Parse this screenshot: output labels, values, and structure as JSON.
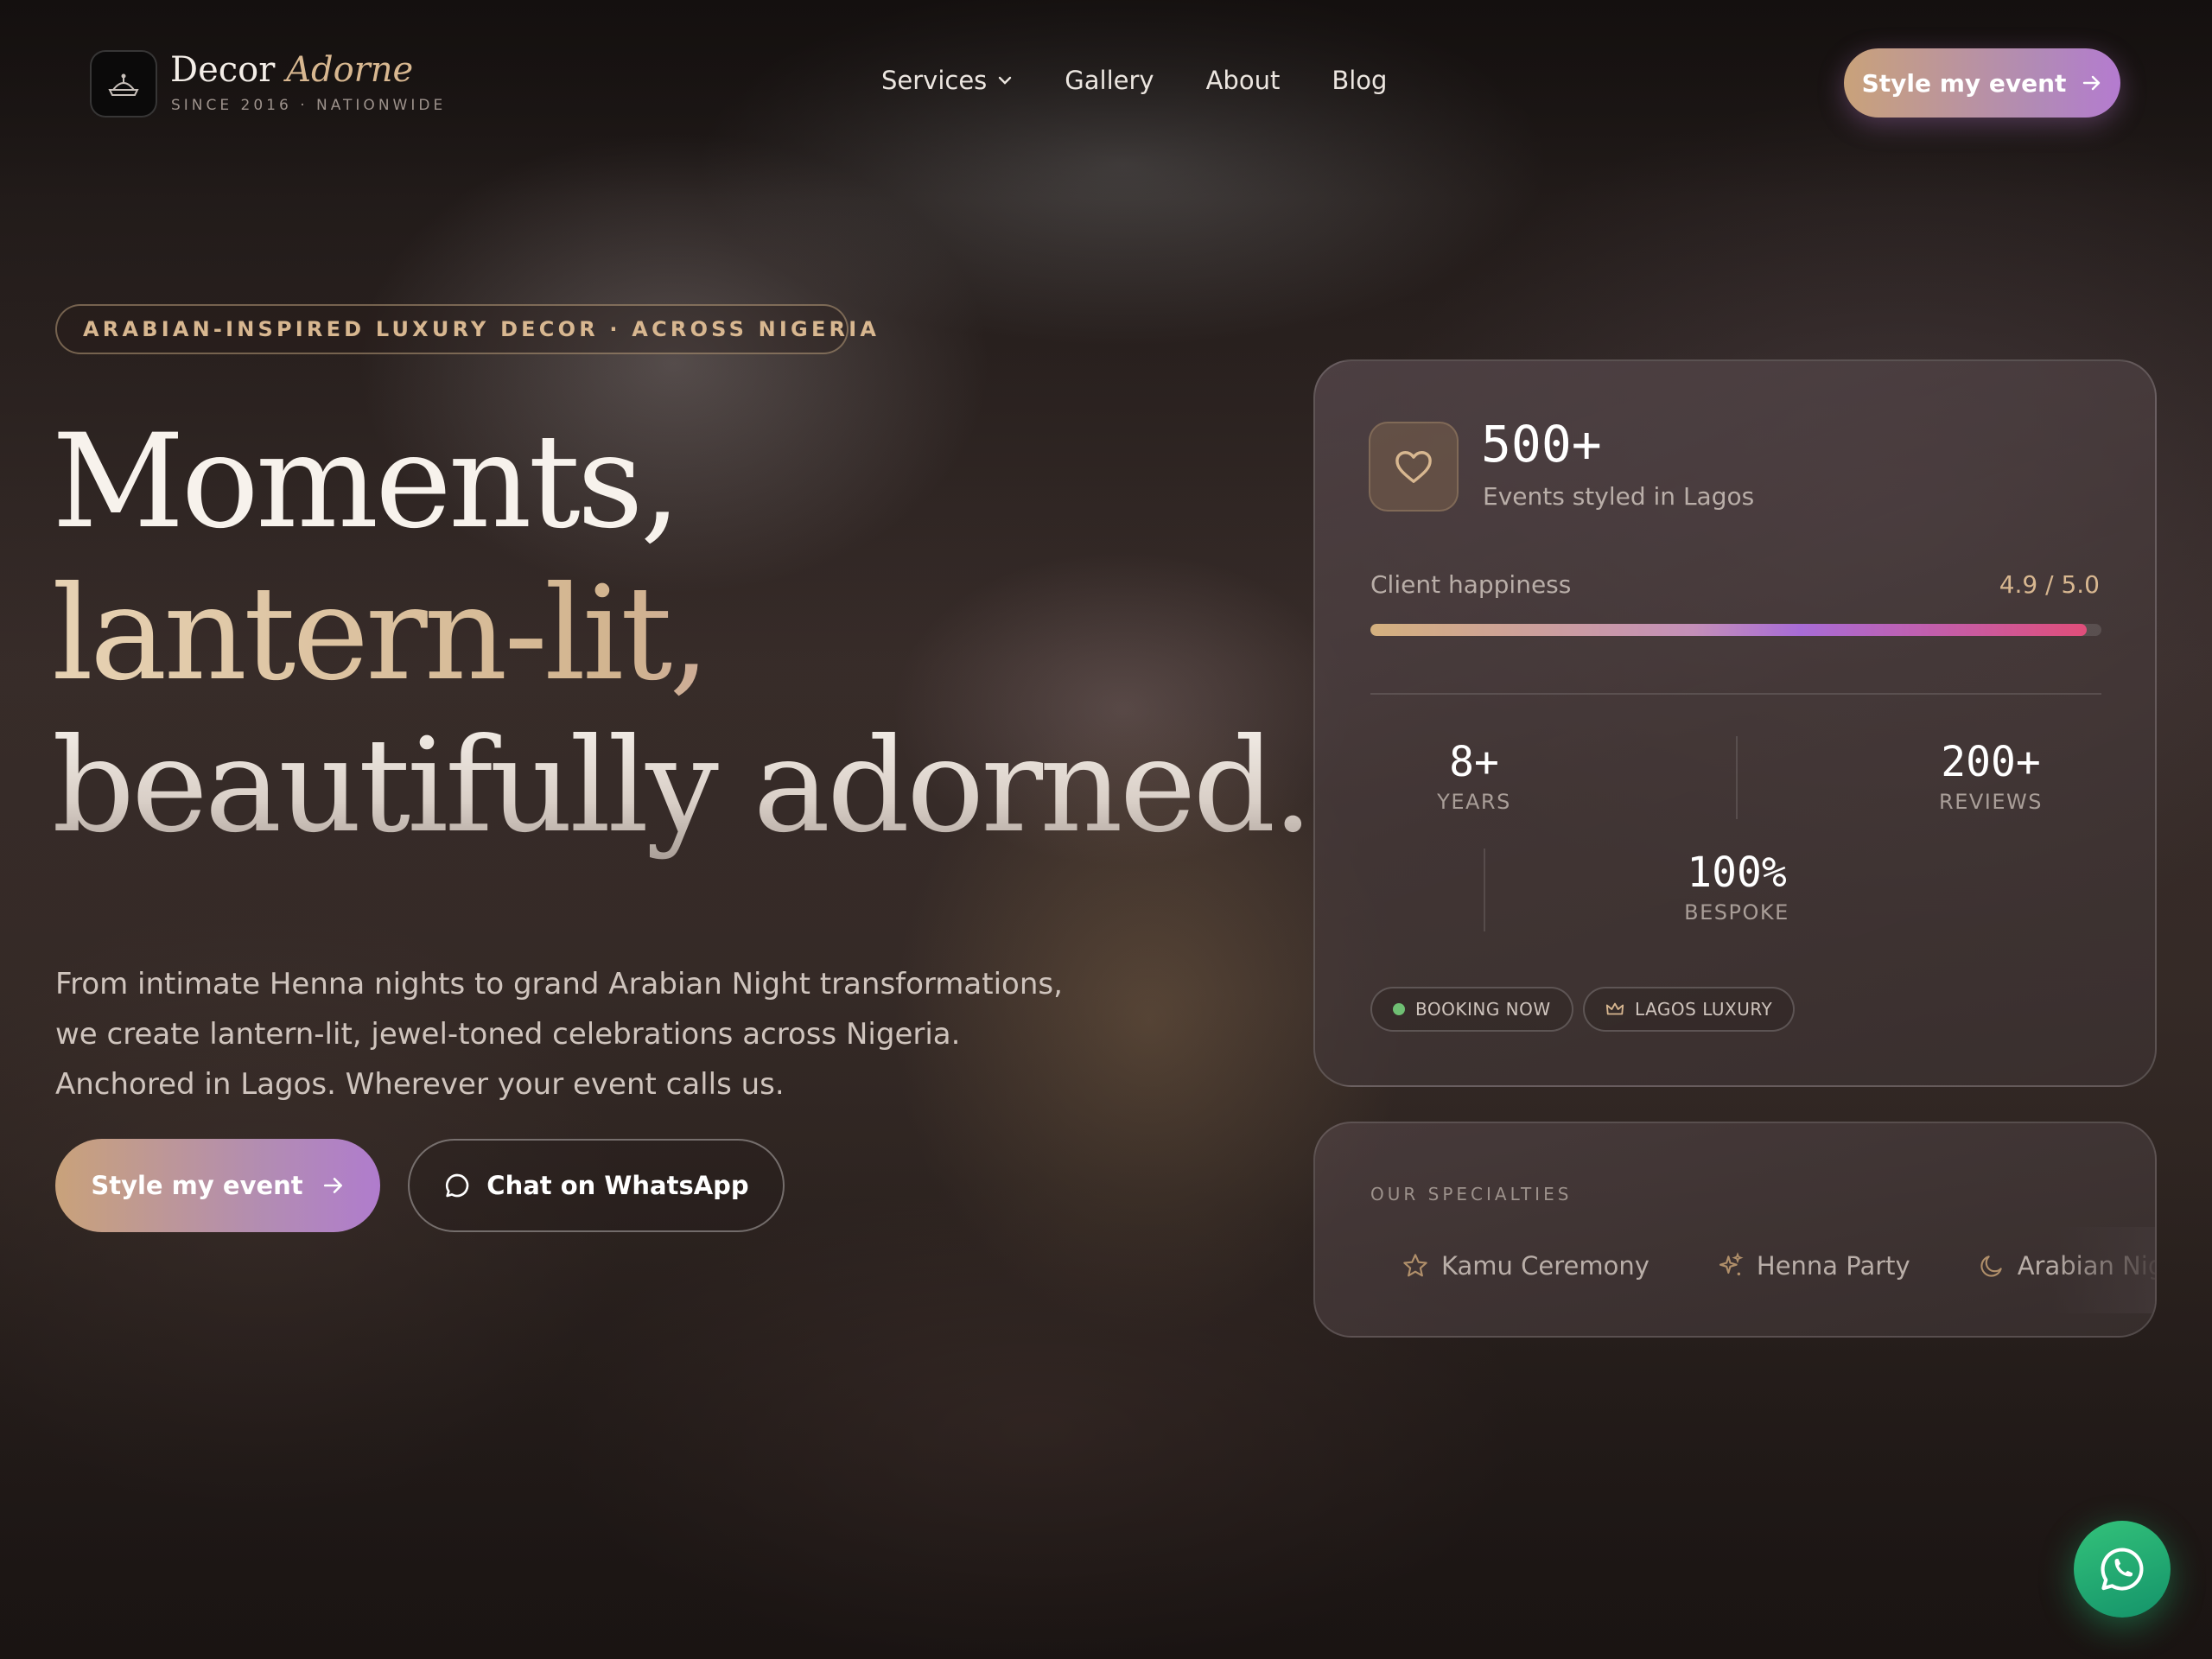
{
  "brand": {
    "name_main": "Decor",
    "name_accent": "Adorne",
    "tagline": "SINCE 2016 · NATIONWIDE",
    "logo_icon": "lantern-crown-icon"
  },
  "nav": {
    "items": [
      {
        "label": "Services",
        "has_dropdown": true
      },
      {
        "label": "Gallery"
      },
      {
        "label": "About"
      },
      {
        "label": "Blog"
      }
    ],
    "cta_label": "Style my event"
  },
  "hero": {
    "badge": "ARABIAN-INSPIRED LUXURY DECOR · ACROSS NIGERIA",
    "headline": [
      "Moments,",
      "lantern-lit,",
      "beautifully adorned."
    ],
    "lede": [
      "From intimate Henna nights to grand Arabian Night transformations,",
      "we create lantern-lit, jewel-toned celebrations across Nigeria.",
      "Anchored in Lagos. Wherever your event calls us."
    ],
    "primary_cta": "Style my event",
    "secondary_cta": "Chat on WhatsApp"
  },
  "stats_card": {
    "headline_value": "500+",
    "headline_label": "Events styled in Lagos",
    "happiness_label": "Client happiness",
    "happiness_value": "4.9 / 5.0",
    "happiness_fraction": 0.98,
    "stats": [
      {
        "value": "8+",
        "label": "YEARS"
      },
      {
        "value": "200+",
        "label": "REVIEWS"
      },
      {
        "value": "100%",
        "label": "BESPOKE"
      }
    ],
    "chips": [
      {
        "label": "BOOKING NOW",
        "icon": "status-dot-icon"
      },
      {
        "label": "LAGOS LUXURY",
        "icon": "crown-icon"
      }
    ]
  },
  "specialties": {
    "title": "OUR SPECIALTIES",
    "items": [
      {
        "label": "Kamu Ceremony",
        "icon": "star-icon"
      },
      {
        "label": "Henna Party",
        "icon": "sparkle-icon"
      },
      {
        "label": "Arabian Night",
        "icon": "moon-icon"
      }
    ]
  },
  "fab": {
    "icon": "whatsapp-icon"
  },
  "colors": {
    "accent_gold": "#d8b790",
    "accent_violet": "#b07ccd",
    "whatsapp_green": "#25b872",
    "booking_dot": "#6fbf73"
  }
}
